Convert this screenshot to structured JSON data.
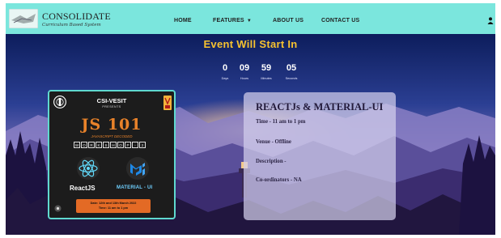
{
  "navbar": {
    "brand": "CONSOLIDATE",
    "tagline": "Curriculum Based System",
    "links": [
      {
        "label": "HOME"
      },
      {
        "label": "FEATURES"
      },
      {
        "label": "ABOUT US"
      },
      {
        "label": "CONTACT US"
      }
    ],
    "icons": [
      "logo-icon",
      "chevron-down-icon",
      "user-icon"
    ]
  },
  "hero": {
    "title": "Event Will Start In",
    "countdown": [
      {
        "value": "0",
        "label": "Days"
      },
      {
        "value": "09",
        "label": "Hours"
      },
      {
        "value": "59",
        "label": "Minutes"
      },
      {
        "value": "05",
        "label": "Seconds"
      }
    ]
  },
  "poster": {
    "organizer": "CSI-VESIT",
    "presents": "PRESENTS",
    "title": "JS 101",
    "subtitle": "JAVASCRIPT DECODED",
    "workshop_letters": [
      "W",
      "O",
      "R",
      "K",
      "S",
      "H",
      "O",
      "P",
      "-",
      "2"
    ],
    "tech_left": "ReactJS",
    "tech_right": "MATERIAL - UI",
    "date_line": "Date: 12th and 13th March 2022",
    "time_line": "Time: 11 am to 1 pm",
    "icons": [
      "csi-logo-icon",
      "vesit-logo-icon",
      "react-icon",
      "material-ui-icon",
      "settings-icon"
    ]
  },
  "event_info": {
    "title": "REACTJs & MATERIAL-UI",
    "time": "Time - 11 am to 1 pm",
    "venue": "Venue - Offline",
    "description": "Description -",
    "coordinators": "Co-ordinators - NA"
  },
  "colors": {
    "navbar_bg": "#7be6dd",
    "title_accent": "#f7c22f",
    "poster_border": "#5fd9cf",
    "poster_accent": "#e8822a"
  }
}
